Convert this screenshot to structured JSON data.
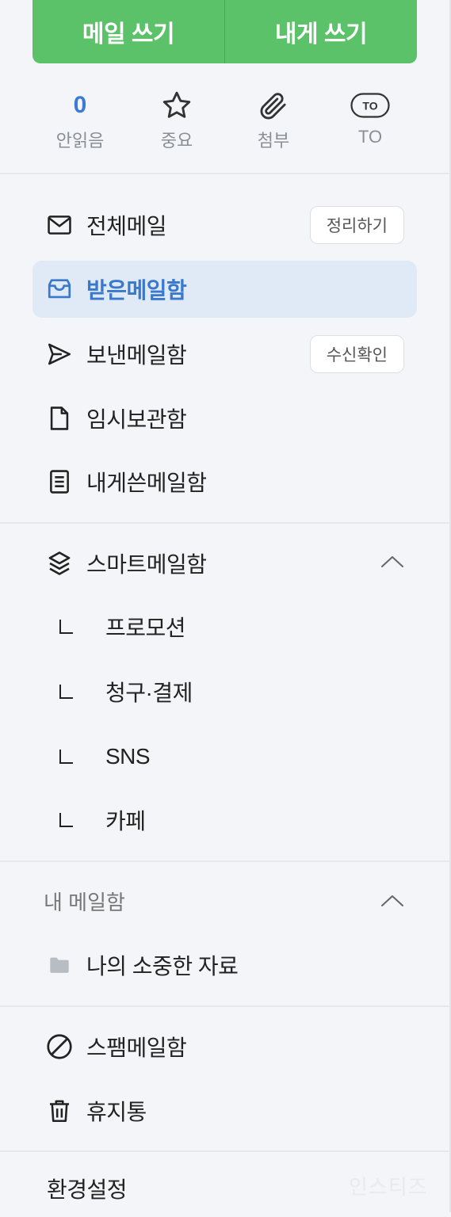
{
  "compose": {
    "write_mail": "메일 쓰기",
    "write_to_me": "내게 쓰기"
  },
  "quick": {
    "unread_count": "0",
    "unread_label": "안읽음",
    "important_label": "중요",
    "attach_label": "첨부",
    "to_badge": "TO",
    "to_label": "TO"
  },
  "nav": {
    "all_mail": "전체메일",
    "all_mail_action": "정리하기",
    "inbox": "받은메일함",
    "sent": "보낸메일함",
    "sent_action": "수신확인",
    "drafts": "임시보관함",
    "to_me": "내게쓴메일함"
  },
  "smart": {
    "title": "스마트메일함",
    "items": [
      "프로모션",
      "청구·결제",
      "SNS",
      "카페"
    ]
  },
  "my_mailbox": {
    "title": "내 메일함",
    "folder": "나의 소중한 자료"
  },
  "bottom": {
    "spam": "스팸메일함",
    "trash": "휴지통",
    "settings": "환경설정"
  },
  "watermark": "인스티즈",
  "colors": {
    "accent_green": "#5cc26a",
    "accent_blue": "#3b7bd4",
    "active_bg": "#dfeaf6"
  }
}
